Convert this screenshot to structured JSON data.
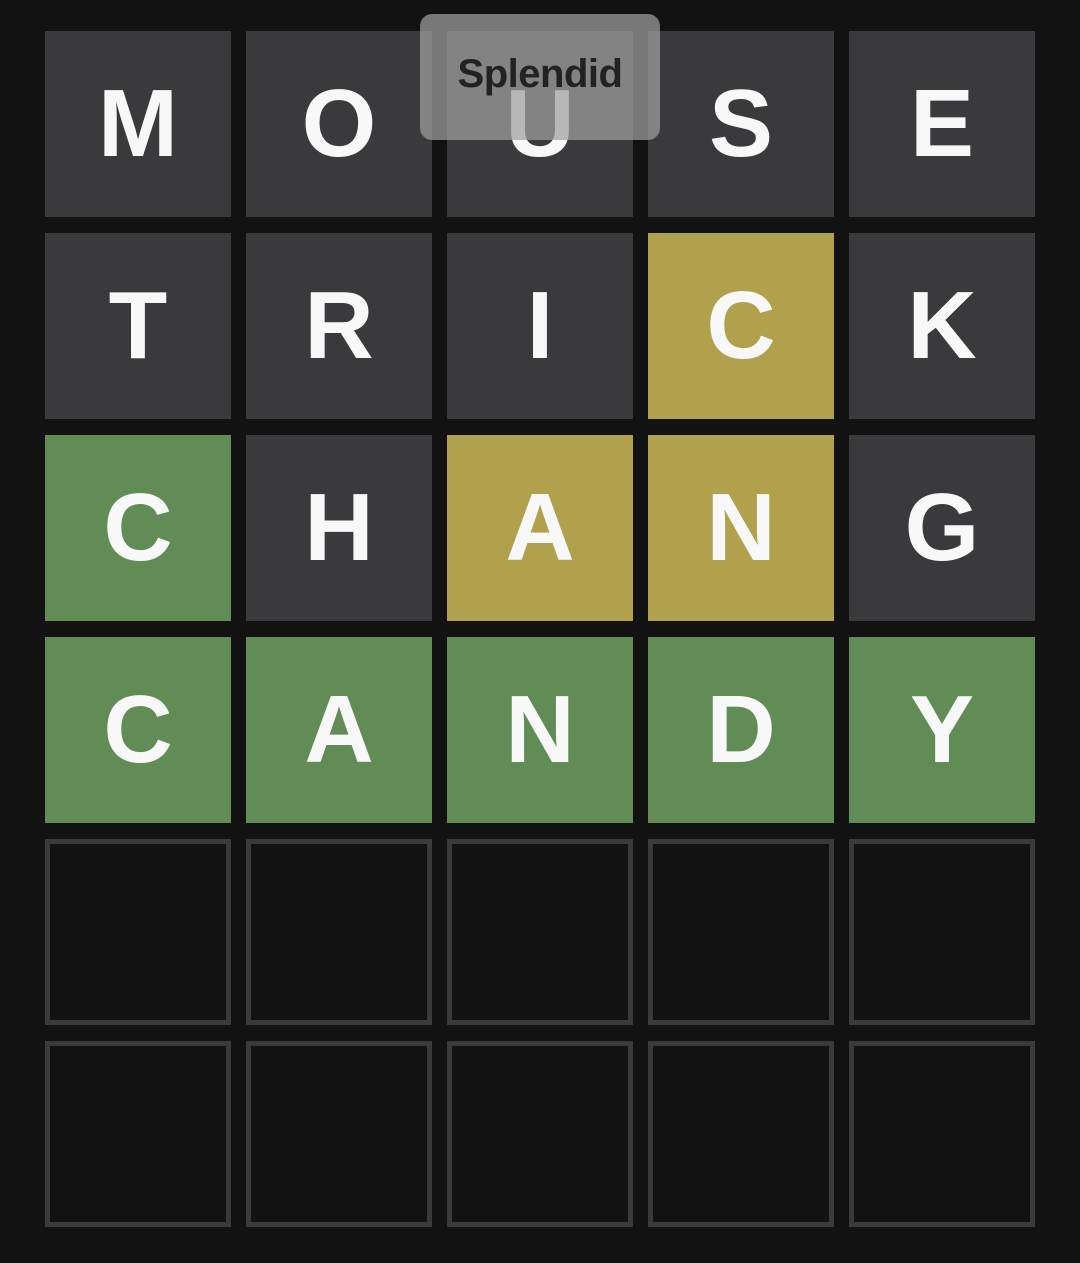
{
  "toast": {
    "message": "Splendid"
  },
  "colors": {
    "background": "#121213",
    "absent": "#3a3a3c",
    "present": "#b1a04c",
    "correct": "#618c55",
    "empty_border": "#3a3a3c"
  },
  "board": {
    "rows": [
      {
        "tiles": [
          {
            "letter": "M",
            "state": "absent"
          },
          {
            "letter": "O",
            "state": "absent"
          },
          {
            "letter": "U",
            "state": "absent"
          },
          {
            "letter": "S",
            "state": "absent"
          },
          {
            "letter": "E",
            "state": "absent"
          }
        ]
      },
      {
        "tiles": [
          {
            "letter": "T",
            "state": "absent"
          },
          {
            "letter": "R",
            "state": "absent"
          },
          {
            "letter": "I",
            "state": "absent"
          },
          {
            "letter": "C",
            "state": "present"
          },
          {
            "letter": "K",
            "state": "absent"
          }
        ]
      },
      {
        "tiles": [
          {
            "letter": "C",
            "state": "correct"
          },
          {
            "letter": "H",
            "state": "absent"
          },
          {
            "letter": "A",
            "state": "present"
          },
          {
            "letter": "N",
            "state": "present"
          },
          {
            "letter": "G",
            "state": "absent"
          }
        ]
      },
      {
        "tiles": [
          {
            "letter": "C",
            "state": "correct"
          },
          {
            "letter": "A",
            "state": "correct"
          },
          {
            "letter": "N",
            "state": "correct"
          },
          {
            "letter": "D",
            "state": "correct"
          },
          {
            "letter": "Y",
            "state": "correct"
          }
        ]
      },
      {
        "tiles": [
          {
            "letter": "",
            "state": "empty"
          },
          {
            "letter": "",
            "state": "empty"
          },
          {
            "letter": "",
            "state": "empty"
          },
          {
            "letter": "",
            "state": "empty"
          },
          {
            "letter": "",
            "state": "empty"
          }
        ]
      },
      {
        "tiles": [
          {
            "letter": "",
            "state": "empty"
          },
          {
            "letter": "",
            "state": "empty"
          },
          {
            "letter": "",
            "state": "empty"
          },
          {
            "letter": "",
            "state": "empty"
          },
          {
            "letter": "",
            "state": "empty"
          }
        ]
      }
    ]
  }
}
